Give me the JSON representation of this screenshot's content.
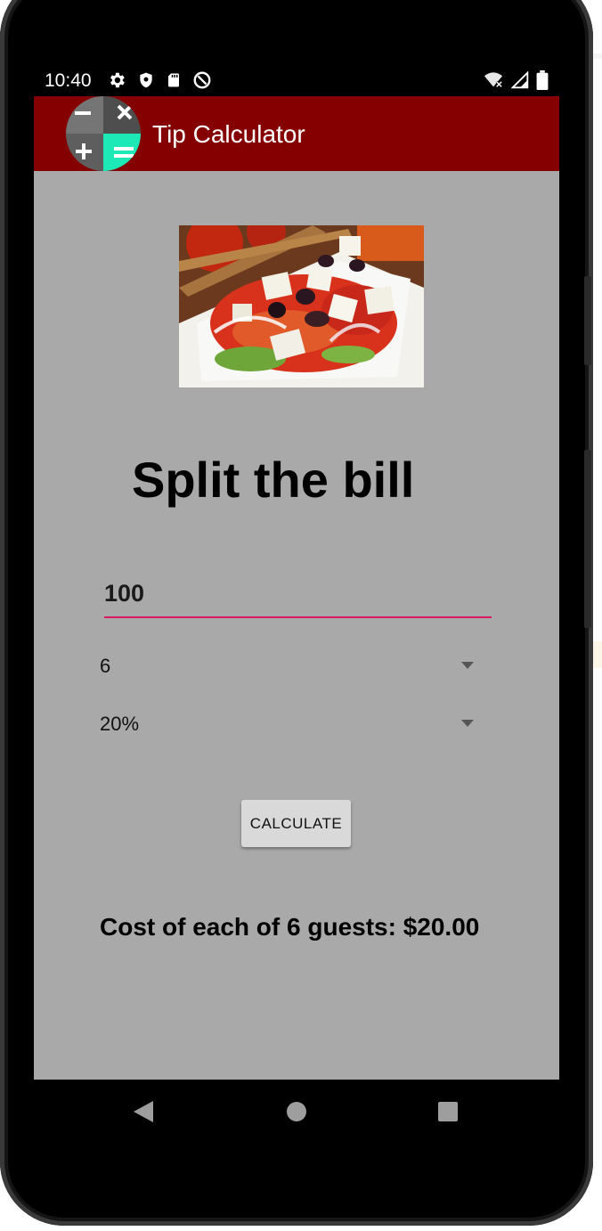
{
  "status_bar": {
    "time": "10:40",
    "left_icons": [
      "gear-icon",
      "shield-icon",
      "sd-card-icon",
      "at-sign-icon"
    ],
    "right_icons": [
      "wifi-off-icon",
      "signal-icon",
      "battery-icon"
    ]
  },
  "app_bar": {
    "title": "Tip Calculator",
    "logo_icon": "calculator-icon"
  },
  "main": {
    "image_icon": "greek-salad-photo",
    "headline": "Split the bill",
    "bill_amount": "100",
    "guests_value": "6",
    "tip_value": "20%",
    "calculate_label": "CALCULATE",
    "result_text": "Cost of each of 6 guests: $20.00"
  },
  "nav_bar": {
    "icons": [
      "back-icon",
      "home-icon",
      "recents-icon"
    ]
  },
  "colors": {
    "app_bar": "#850000",
    "screen_background": "#a9a9a9",
    "input_underline": "#d81b60",
    "accent_mint": "#1de9b6"
  }
}
